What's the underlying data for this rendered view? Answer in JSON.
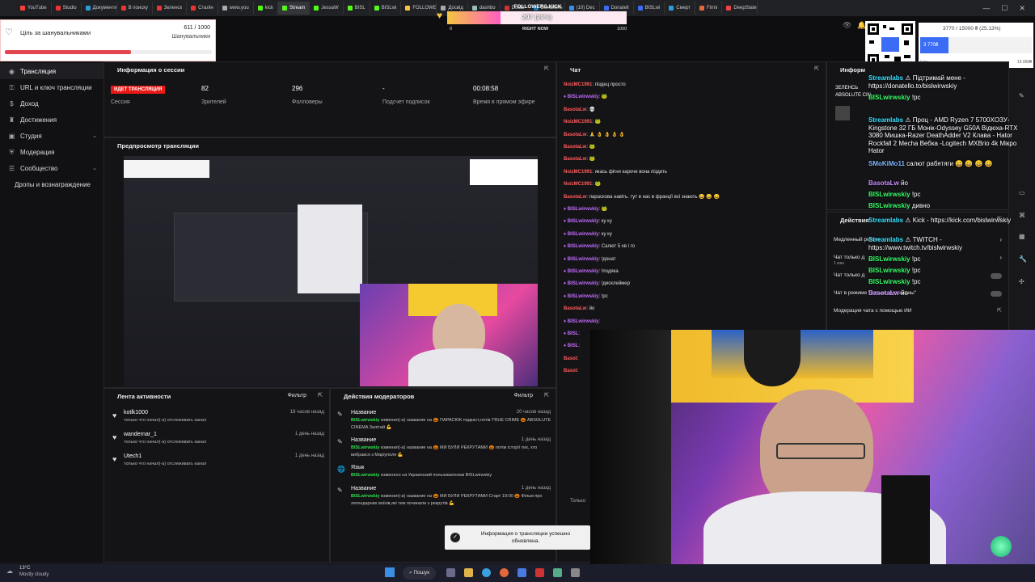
{
  "browser": {
    "tabs": [
      "YouTube",
      "Studio",
      "Документи / Історія",
      "В поиску",
      "Зеленск",
      "Сталін",
      "www.you",
      "kick",
      "Stream",
      "JessaW",
      "BISL",
      "BISLwi",
      "FOLLOWERS.KICK",
      "Досвід",
      "dashbo",
      "Dota2",
      "Donations",
      "(10) Dec",
      "Donatell",
      "BISLwi",
      "Смерт",
      "Firmi",
      "DeepState"
    ],
    "active_tab": "Stream"
  },
  "goal_widget": {
    "title": "Ціль за шанувальниками",
    "value": "611 / 1000",
    "label": "Шанувальники",
    "progress": 0.611
  },
  "followers_bar": {
    "title": "FOLLOWERS.KICK",
    "count": "297 (29%)",
    "min": "0",
    "right_now": "RIGHT NOW",
    "max": "1000",
    "progress": 0.297
  },
  "donation_bar": {
    "text": "3770 / 15000 ₴ (25.13%)",
    "current": "3 770₴",
    "goal_label": "Ціль",
    "goal_value": "15 000₴",
    "progress": 0.2513
  },
  "left_nav": {
    "items": [
      {
        "label": "Трансляция",
        "icon": "broadcast-icon",
        "active": true
      },
      {
        "label": "URL и ключ трансляции",
        "icon": "key-icon"
      },
      {
        "label": "Доход",
        "icon": "wallet-icon"
      },
      {
        "label": "Достижения",
        "icon": "trophy-icon"
      },
      {
        "label": "Студия",
        "icon": "studio-icon",
        "chevron": true
      },
      {
        "label": "Модерация",
        "icon": "shield-icon"
      },
      {
        "label": "Сообщество",
        "icon": "community-icon",
        "chevron": true
      },
      {
        "label": "Дропы и вознаграждение",
        "icon": ""
      }
    ]
  },
  "session_panel": {
    "title": "Информация о сессии",
    "live_badge": "ИДЕТ ТРАНСЛЯЦИЯ",
    "session_label": "Сессия",
    "viewers": "82",
    "viewers_label": "Зрителей",
    "followers": "296",
    "followers_label": "Фолловеры",
    "subs": "-",
    "subs_label": "Подсчет подписок",
    "uptime": "00:08:58",
    "uptime_label": "Время в прямом эфире"
  },
  "preview_panel": {
    "title": "Предпросмотр трансляции"
  },
  "activity_panel": {
    "title": "Лента активности",
    "filter": "Фильтр",
    "items": [
      {
        "name": "kotlk1000",
        "desc": "только что начал(-а) отслеживать канал",
        "time": "18 часов назад"
      },
      {
        "name": "wandernar_1",
        "desc": "только что начал(-а) отслеживать канал",
        "time": "1 день назад"
      },
      {
        "name": "Utech1",
        "desc": "только что начал(-а) отслеживать канал",
        "time": "1 день назад"
      }
    ]
  },
  "mod_panel": {
    "title": "Действия модераторов",
    "filter": "Фильтр",
    "items": [
      {
        "icon": "pencil-icon",
        "head": "Название",
        "time": "20 часов назад",
        "user": "BISLwirwskiy",
        "text": "изменил(-а) название на 🎃 ПАРАСЮК подкаст,лотів TRUE CRIME 🎃 ABSOLUTE CINEMA Залітай 💪"
      },
      {
        "icon": "pencil-icon",
        "head": "Название",
        "time": "1 день назад",
        "user": "BISLwirwskiy",
        "text": "изменил(-а) название на 🎃 МИ БУЛИ РЕКРУТАМИ 🎃 потім історії тих, хто вибрався з Маріуполя 💪"
      },
      {
        "icon": "globe-icon",
        "head": "Язык",
        "time": "",
        "user": "BISLwirwskiy",
        "text": "изменено на Украинский пользователем BISLwirwskiy"
      },
      {
        "icon": "pencil-icon",
        "head": "Название",
        "time": "1 день назад",
        "user": "BISLwirwskiy",
        "text": "изменил(-а) название на 🎃 МИ БУЛИ РЕКРУТАМИ Старт 19:00 🎃 Фільм про легендарних воїнів,які теж починали з рекрутів 💪"
      }
    ]
  },
  "chat_panel": {
    "title": "Чат",
    "lines": [
      {
        "user": "NoizMC1991",
        "text": "піздец просто",
        "color": "red"
      },
      {
        "user": "BISLwirwskiy",
        "text": "🐸",
        "color": "mag"
      },
      {
        "user": "BasotaLw",
        "text": "💀",
        "color": "red"
      },
      {
        "user": "NoizMC1991",
        "text": "🐸",
        "color": "red"
      },
      {
        "user": "BasotaLw",
        "text": "🙏 👌 👌 👌 👌",
        "color": "red"
      },
      {
        "user": "BasotaLw",
        "text": "🐸",
        "color": "red"
      },
      {
        "user": "BasotaLw",
        "text": "🐸",
        "color": "red"
      },
      {
        "user": "NoizMC1991",
        "text": "якась фігня кароче вона піздить",
        "color": "red"
      },
      {
        "user": "NoizMC1991",
        "text": "🐸",
        "color": "red"
      },
      {
        "user": "BasotaLw",
        "text": "параскова навіть. тут в нас в франції всі знають 😄 😄 😄",
        "color": "red"
      },
      {
        "user": "BISLwirwskiy",
        "text": "🐸",
        "color": "mag"
      },
      {
        "user": "BISLwirwskiy",
        "text": "ку ку",
        "color": "mag"
      },
      {
        "user": "BISLwirwskiy",
        "text": "ку ку",
        "color": "mag"
      },
      {
        "user": "BISLwirwskiy",
        "text": "Салют 5 хв і го",
        "color": "mag"
      },
      {
        "user": "BISLwirwskiy",
        "text": "!донат",
        "color": "mag"
      },
      {
        "user": "BISLwirwskiy",
        "text": "!подяка",
        "color": "mag"
      },
      {
        "user": "BISLwirwskiy",
        "text": "!дисклеймер",
        "color": "mag"
      },
      {
        "user": "BISLwirwskiy",
        "text": "!рс",
        "color": "mag"
      },
      {
        "user": "BasotaLw",
        "text": "йо",
        "color": "red"
      },
      {
        "user": "BISLwirwskiy",
        "text": "",
        "color": "mag"
      },
      {
        "user": "BISL",
        "text": "",
        "color": "mag"
      },
      {
        "user": "BISL",
        "text": "",
        "color": "mag"
      },
      {
        "user": "Basot",
        "text": "",
        "color": "red"
      },
      {
        "user": "Basot",
        "text": "",
        "color": "red"
      }
    ],
    "hidden_notice": "Только"
  },
  "info_panel": {
    "title": "Информ"
  },
  "mod_actions_panel": {
    "title": "Действия",
    "rows": [
      {
        "label": "Медленный режим",
        "control": "arrow"
      },
      {
        "label": "Чат только д",
        "sub": "1 мин",
        "control": "arrow"
      },
      {
        "label": "Чат только д",
        "control": "toggle"
      },
      {
        "label": "Чат в режиме \"только эмотиконы\"",
        "control": "toggle"
      },
      {
        "label": "Модерация чата с помощью ИИ",
        "control": "popout"
      }
    ]
  },
  "overlay_chat": {
    "lines": [
      {
        "user": "Streamlabs",
        "text": "⚠ Підтримай мене - https://donatello.to/bislwirwskiy",
        "color": "teal"
      },
      {
        "user": "BISLwirwskiy",
        "text": "!рс",
        "color": "green"
      },
      {
        "user": "Streamlabs",
        "text": "⚠ Проц - AMD Ryzen 7 5700XОЗУ-Kingstone 32 ГБ Монік-Odyssey G50A Відюха-RTX 3080 Мишка-Razer DeathAdder V2 Клава - Hator Rockfall 2 Mecha Вебка -Logitech MXBrio 4k Мікро Hator",
        "color": "teal"
      },
      {
        "user": "SMoKiMo11",
        "text": "салют рабятяги 😄 😄 😄 😄",
        "color": "blue"
      },
      {
        "user": "BasotaLw",
        "text": "йо",
        "color": "mag"
      },
      {
        "user": "BISLwirwskiy",
        "text": "!рс",
        "color": "green"
      },
      {
        "user": "BISLwirwskiy",
        "text": "дивно",
        "color": "green"
      },
      {
        "user": "Streamlabs",
        "text": "⚠ Kick - https://kick.com/bislwirwskiy",
        "color": "teal"
      },
      {
        "user": "Streamlabs",
        "text": "⚠ TWITCH - https://www.twitch.tv/bislwirwskiy",
        "color": "teal"
      },
      {
        "user": "BISLwirwskiy",
        "text": "!рс",
        "color": "green"
      },
      {
        "user": "BISLwirwskiy",
        "text": "!рс",
        "color": "green"
      },
      {
        "user": "BISLwirwskiy",
        "text": "!рс",
        "color": "green"
      },
      {
        "user": "BasotaLw",
        "text": "йо",
        "color": "mag"
      }
    ],
    "info_fragment": "ЗЕЛЕНСЬ ABSOLUTE CIN"
  },
  "toast": {
    "text": "Информация о трансляции успешно обновлена."
  },
  "taskbar": {
    "weather_temp": "13°C",
    "weather_desc": "Mostly cloudy",
    "search_label": "Пошук"
  },
  "colors": {
    "kick_green": "#53fc18",
    "live_red": "#e91916",
    "goal_bar": "#e2454c",
    "bg": "#18181b",
    "followers_bar": "#ff5fc0"
  }
}
